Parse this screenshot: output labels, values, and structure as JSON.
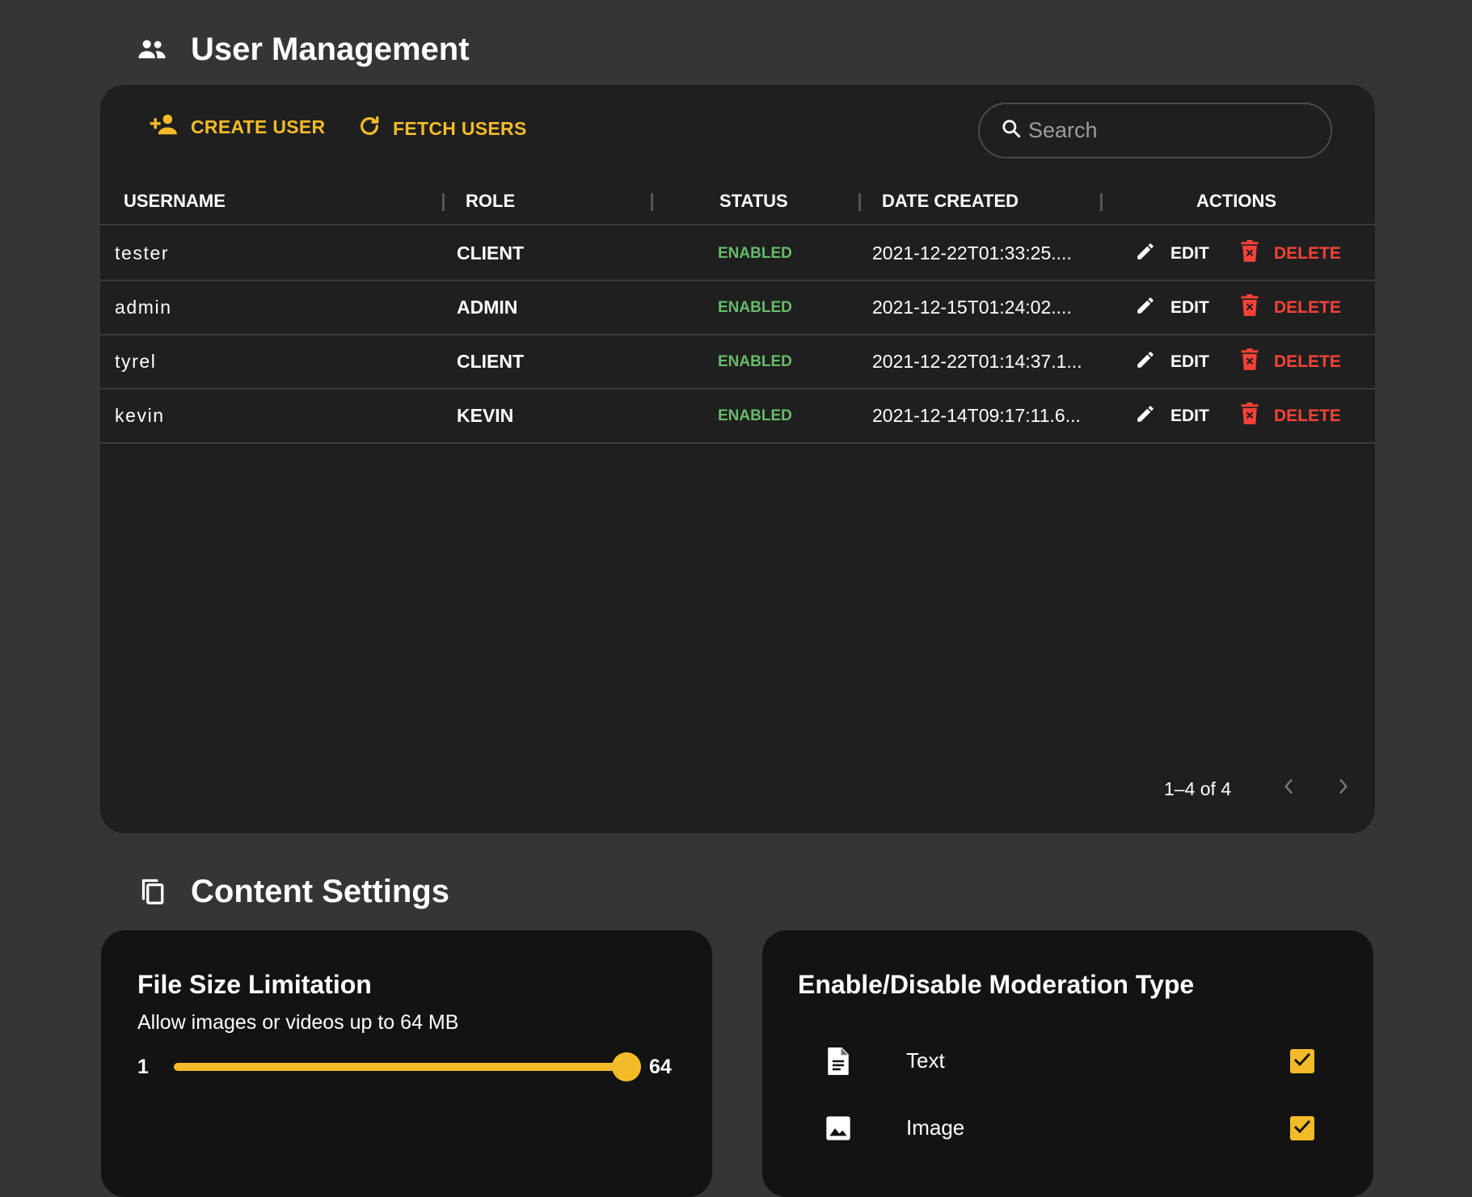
{
  "user_management": {
    "title": "User Management",
    "create_user_label": "CREATE USER",
    "fetch_users_label": "FETCH USERS",
    "search_placeholder": "Search",
    "columns": [
      "USERNAME",
      "ROLE",
      "STATUS",
      "DATE CREATED",
      "ACTIONS"
    ],
    "rows": [
      {
        "username": "tester",
        "role": "CLIENT",
        "status": "ENABLED",
        "date": "2021-12-22T01:33:25....",
        "edit": "EDIT",
        "delete": "DELETE"
      },
      {
        "username": "admin",
        "role": "ADMIN",
        "status": "ENABLED",
        "date": "2021-12-15T01:24:02....",
        "edit": "EDIT",
        "delete": "DELETE"
      },
      {
        "username": "tyrel",
        "role": "CLIENT",
        "status": "ENABLED",
        "date": "2021-12-22T01:14:37.1...",
        "edit": "EDIT",
        "delete": "DELETE"
      },
      {
        "username": "kevin",
        "role": "KEVIN",
        "status": "ENABLED",
        "date": "2021-12-14T09:17:11.6...",
        "edit": "EDIT",
        "delete": "DELETE"
      }
    ],
    "pagination": "1–4 of 4"
  },
  "content_settings": {
    "title": "Content Settings",
    "file_size": {
      "heading": "File Size Limitation",
      "description": "Allow images or videos up to 64 MB",
      "min_label": "1",
      "max_label": "64",
      "min": 1,
      "max": 64,
      "value": 64
    },
    "moderation": {
      "heading": "Enable/Disable Moderation Type",
      "items": [
        {
          "label": "Text",
          "icon": "document-icon",
          "checked": true
        },
        {
          "label": "Image",
          "icon": "image-icon",
          "checked": true
        }
      ]
    }
  },
  "colors": {
    "accent": "#f4bb29",
    "enabled": "#66bb6a",
    "danger": "#f44336",
    "background": "#353535",
    "card": "#1f1f1f"
  }
}
